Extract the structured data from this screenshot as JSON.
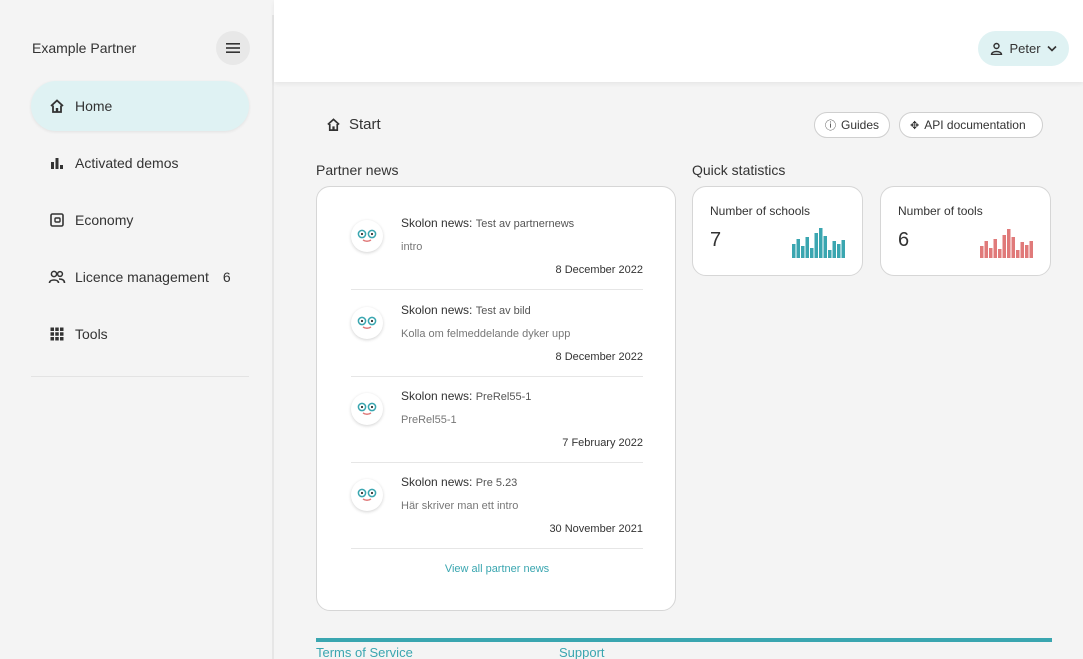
{
  "sidebar": {
    "brand": "Example Partner",
    "items": [
      {
        "label": "Home",
        "icon": "home-icon"
      },
      {
        "label": "Activated demos",
        "icon": "bar-chart-icon"
      },
      {
        "label": "Economy",
        "icon": "wallet-icon"
      },
      {
        "label": "Licence management",
        "icon": "users-icon",
        "badge": "6"
      },
      {
        "label": "Tools",
        "icon": "grid-icon"
      }
    ]
  },
  "header": {
    "user_name": "Peter"
  },
  "main": {
    "breadcrumb": "Start",
    "guides_label": "Guides",
    "api_label": "API documentation",
    "news_title": "Partner news",
    "stats_title": "Quick statistics"
  },
  "news": [
    {
      "source": "Skolon news:",
      "subject": "Test av partnernews",
      "intro": "intro",
      "date": "8 December 2022"
    },
    {
      "source": "Skolon news:",
      "subject": "Test av bild",
      "intro": "Kolla om felmeddelande dyker upp",
      "date": "8 December 2022"
    },
    {
      "source": "Skolon news:",
      "subject": "PreRel55-1",
      "intro": "PreRel55-1",
      "date": "7 February 2022"
    },
    {
      "source": "Skolon news:",
      "subject": "Pre 5.23",
      "intro": "Här skriver man ett intro",
      "date": "30 November 2021"
    }
  ],
  "view_all": "View all partner news",
  "stats": [
    {
      "label": "Number of schools",
      "value": "7",
      "color": "#3aa6b0"
    },
    {
      "label": "Number of tools",
      "value": "6",
      "color": "#e07a7a"
    }
  ],
  "footer": {
    "terms": "Terms of Service",
    "support": "Support"
  },
  "colors": {
    "accent": "#3aa6b0",
    "active_nav": "#dff2f3"
  }
}
